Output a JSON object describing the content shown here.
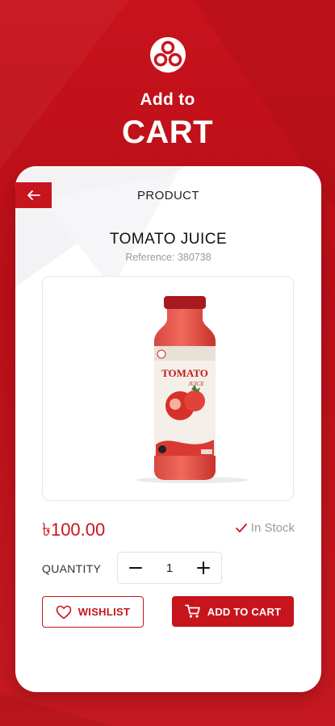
{
  "hero": {
    "subtitle": "Add to",
    "title": "CART"
  },
  "card": {
    "label": "PRODUCT",
    "back_icon": "arrow-left-icon"
  },
  "product": {
    "name": "TOMATO JUICE",
    "reference": "Reference: 380738",
    "image": "tomato-juice-bottle",
    "bottle_label_line1": "TOMATO",
    "bottle_label_line2": "JUICE",
    "price": "৳100.00",
    "stock_status": "In Stock"
  },
  "quantity": {
    "label": "QUANTITY",
    "value": "1",
    "minus_icon": "minus-icon",
    "plus_icon": "plus-icon"
  },
  "actions": {
    "wishlist_label": "WISHLIST",
    "wishlist_icon": "heart-icon",
    "add_to_cart_label": "ADD TO CART",
    "cart_icon": "cart-icon"
  },
  "colors": {
    "brand_red": "#c8151d",
    "muted_text": "#9a9a9a"
  }
}
